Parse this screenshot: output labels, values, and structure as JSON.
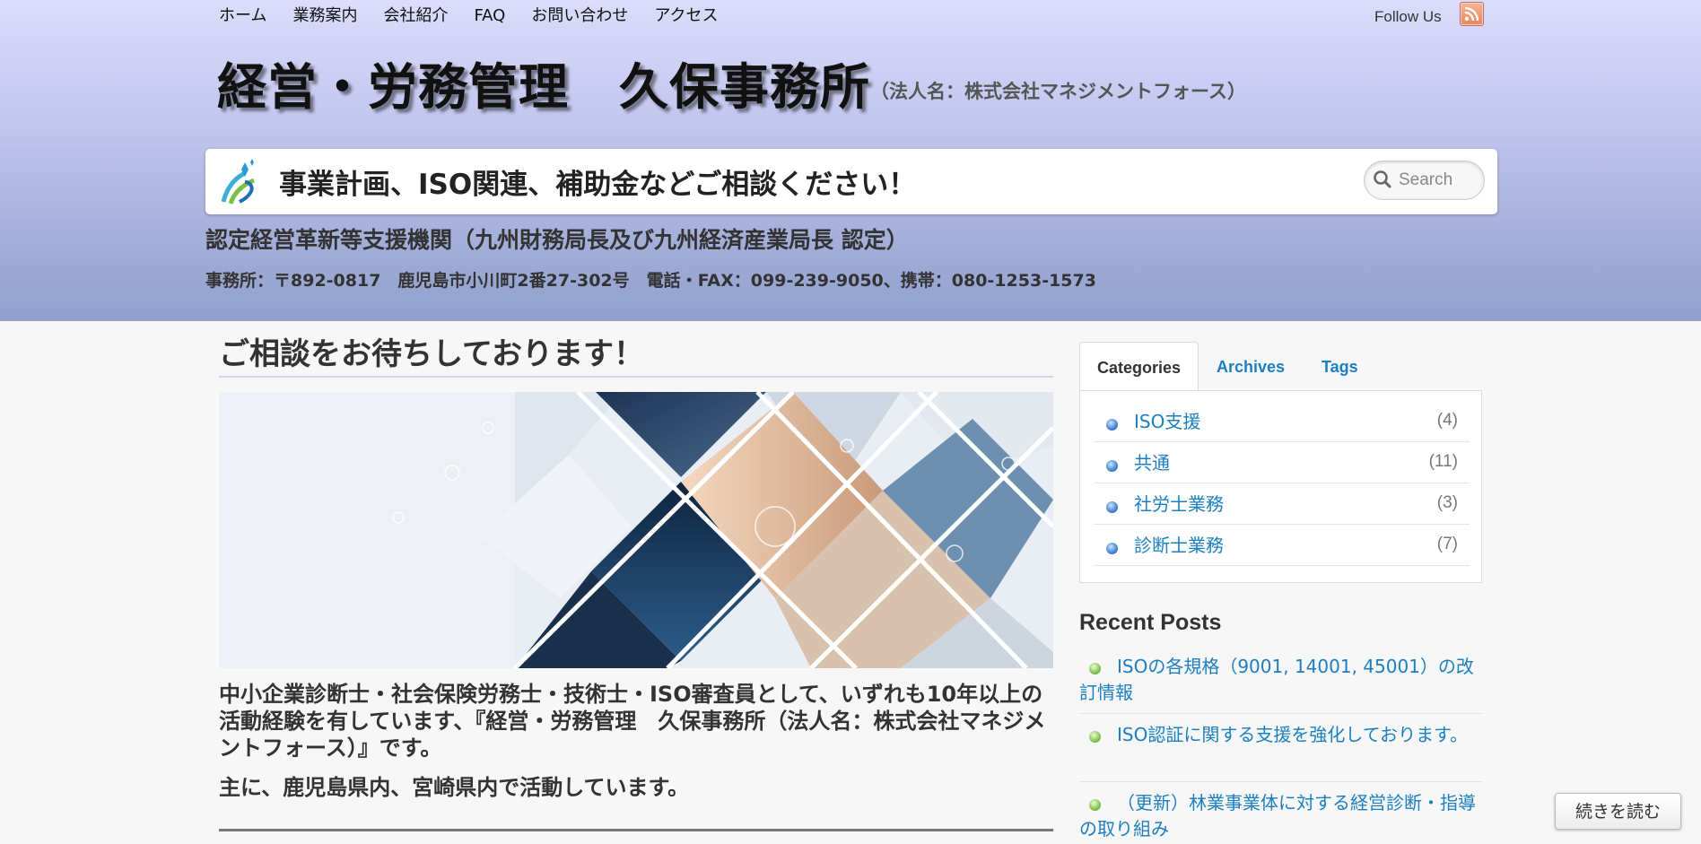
{
  "nav": {
    "items": [
      "ホーム",
      "業務案内",
      "会社紹介",
      "FAQ",
      "お問い合わせ",
      "アクセス"
    ],
    "follow_us": "Follow Us"
  },
  "site": {
    "title": "経営・労務管理　久保事務所",
    "subtitle": "（法人名：株式会社マネジメントフォース）",
    "banner_text": "事業計画、ISO関連、補助金などご相談ください！",
    "certification": "認定経営革新等支援機関（九州財務局長及び九州経済産業局長 認定）",
    "address": "事務所：〒892-0817　鹿児島市小川町2番27-302号　電話・FAX：099-239-9050、携帯：080-1253-1573"
  },
  "search": {
    "placeholder": "Search"
  },
  "post": {
    "title": "ご相談をお待ちしております！",
    "intro": "中小企業診断士・社会保険労務士・技術士・ISO審査員として、いずれも10年以上の活動経験を有しています、『経営・労務管理　久保事務所（法人名：株式会社マネジメントフォース）』です。",
    "intro2": "主に、鹿児島県内、宮崎県内で活動しています。"
  },
  "sidebar": {
    "tabs": [
      "Categories",
      "Archives",
      "Tags"
    ],
    "categories": [
      {
        "label": "ISO支援",
        "count": "(4)"
      },
      {
        "label": "共通",
        "count": "(11)"
      },
      {
        "label": "社労士業務",
        "count": "(3)"
      },
      {
        "label": "診断士業務",
        "count": "(7)"
      }
    ],
    "recent_title": "Recent Posts",
    "recent_posts": [
      "ISOの各規格（9001, 14001, 45001）の改訂情報",
      "ISO認証に関する支援を強化しております。",
      "（更新）林業事業体に対する経営診断・指導の取り組み"
    ]
  },
  "read_more": "続きを読む",
  "colors": {
    "link": "#1b7fc0",
    "header_top": "#dcdcfb",
    "header_bottom": "#8f9fcc"
  },
  "icons": [
    "rss-icon",
    "search-icon",
    "logo-icon"
  ]
}
